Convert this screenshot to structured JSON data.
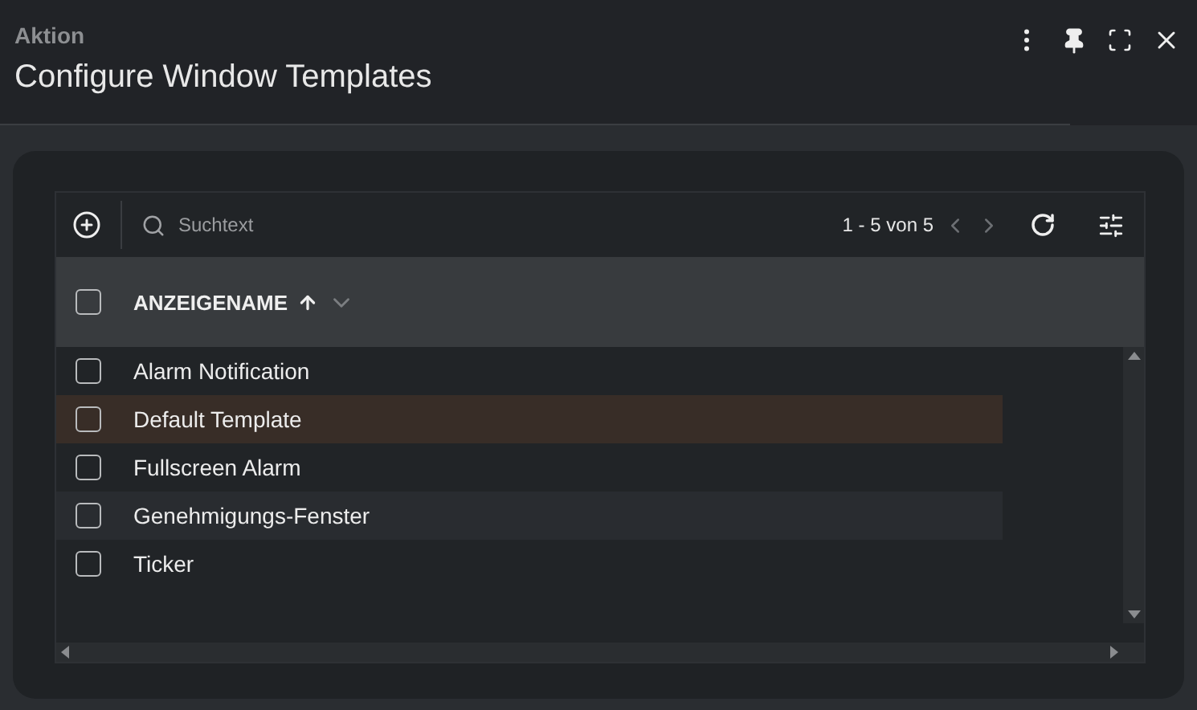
{
  "header": {
    "subtitle": "Aktion",
    "title": "Configure Window Templates"
  },
  "toolbar": {
    "search": {
      "placeholder": "Suchtext"
    },
    "pagination": "1 - 5 von 5"
  },
  "table": {
    "select_all_checked": false,
    "columns": [
      {
        "label": "ANZEIGENAME",
        "sorted": true,
        "descending": false
      }
    ],
    "rows": [
      {
        "name": "Alarm Notification",
        "checked": false,
        "selected": false
      },
      {
        "name": "Default Template",
        "checked": false,
        "selected": true
      },
      {
        "name": "Fullscreen Alarm",
        "checked": false,
        "selected": false
      },
      {
        "name": "Genehmigungs-Fenster",
        "checked": false,
        "selected": false
      },
      {
        "name": "Ticker",
        "checked": false,
        "selected": false
      }
    ]
  }
}
